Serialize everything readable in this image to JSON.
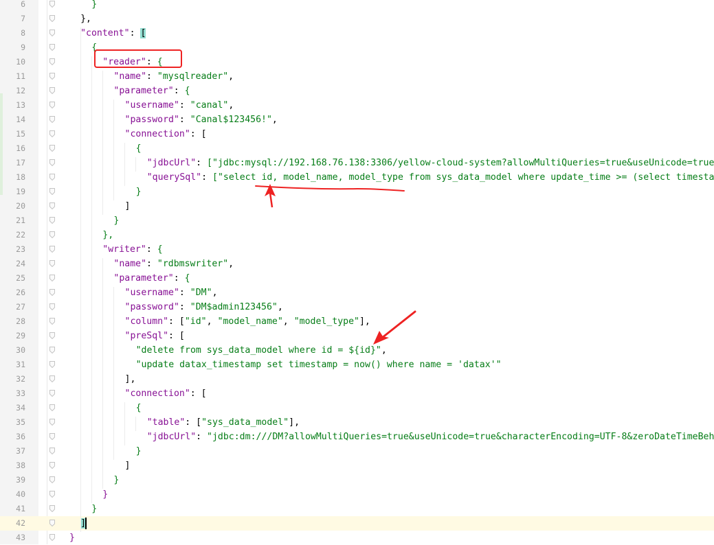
{
  "editor": {
    "lines": [
      {
        "n": "6",
        "indent": 8,
        "tokens": [
          {
            "t": "}",
            "c": "s"
          }
        ]
      },
      {
        "n": "7",
        "indent": 6,
        "tokens": [
          {
            "t": "},",
            "c": "p"
          }
        ]
      },
      {
        "n": "8",
        "indent": 6,
        "tokens": [
          {
            "t": "\"content\"",
            "c": "k"
          },
          {
            "t": ": ",
            "c": "p"
          },
          {
            "t": "[",
            "c": "bh"
          }
        ]
      },
      {
        "n": "9",
        "indent": 8,
        "tokens": [
          {
            "t": "{",
            "c": "s"
          }
        ]
      },
      {
        "n": "10",
        "indent": 10,
        "tokens": [
          {
            "t": "\"reader\"",
            "c": "k"
          },
          {
            "t": ": ",
            "c": "p"
          },
          {
            "t": "{",
            "c": "s"
          }
        ]
      },
      {
        "n": "11",
        "indent": 12,
        "tokens": [
          {
            "t": "\"name\"",
            "c": "k"
          },
          {
            "t": ": ",
            "c": "p"
          },
          {
            "t": "\"mysqlreader\"",
            "c": "s"
          },
          {
            "t": ",",
            "c": "p"
          }
        ]
      },
      {
        "n": "12",
        "indent": 12,
        "tokens": [
          {
            "t": "\"parameter\"",
            "c": "k"
          },
          {
            "t": ": ",
            "c": "p"
          },
          {
            "t": "{",
            "c": "s"
          }
        ]
      },
      {
        "n": "13",
        "indent": 14,
        "tokens": [
          {
            "t": "\"username\"",
            "c": "k"
          },
          {
            "t": ": ",
            "c": "p"
          },
          {
            "t": "\"canal\"",
            "c": "s"
          },
          {
            "t": ",",
            "c": "p"
          }
        ]
      },
      {
        "n": "14",
        "indent": 14,
        "tokens": [
          {
            "t": "\"password\"",
            "c": "k"
          },
          {
            "t": ": ",
            "c": "p"
          },
          {
            "t": "\"Canal$123456!\"",
            "c": "s"
          },
          {
            "t": ",",
            "c": "p"
          }
        ]
      },
      {
        "n": "15",
        "indent": 14,
        "tokens": [
          {
            "t": "\"connection\"",
            "c": "k"
          },
          {
            "t": ": ",
            "c": "p"
          },
          {
            "t": "[",
            "c": "p"
          }
        ]
      },
      {
        "n": "16",
        "indent": 16,
        "tokens": [
          {
            "t": "{",
            "c": "s"
          }
        ]
      },
      {
        "n": "17",
        "indent": 18,
        "tokens": [
          {
            "t": "\"jdbcUrl\"",
            "c": "k"
          },
          {
            "t": ": ",
            "c": "p"
          },
          {
            "t": "[",
            "c": "s"
          },
          {
            "t": "\"jdbc:mysql://192.168.76.138:3306/yellow-cloud-system?allowMultiQueries=true&useUnicode=true",
            "c": "s"
          }
        ]
      },
      {
        "n": "18",
        "indent": 18,
        "tokens": [
          {
            "t": "\"querySql\"",
            "c": "k"
          },
          {
            "t": ": ",
            "c": "p"
          },
          {
            "t": "[",
            "c": "s"
          },
          {
            "t": "\"select id, model_name, model_type from sys_data_model where update_time >= (select timestamp",
            "c": "s"
          }
        ]
      },
      {
        "n": "19",
        "indent": 16,
        "tokens": [
          {
            "t": "}",
            "c": "s"
          }
        ]
      },
      {
        "n": "20",
        "indent": 14,
        "tokens": [
          {
            "t": "]",
            "c": "p"
          }
        ]
      },
      {
        "n": "21",
        "indent": 12,
        "tokens": [
          {
            "t": "}",
            "c": "s"
          }
        ]
      },
      {
        "n": "22",
        "indent": 10,
        "tokens": [
          {
            "t": "},",
            "c": "s"
          }
        ]
      },
      {
        "n": "23",
        "indent": 10,
        "tokens": [
          {
            "t": "\"writer\"",
            "c": "k"
          },
          {
            "t": ": ",
            "c": "p"
          },
          {
            "t": "{",
            "c": "s"
          }
        ]
      },
      {
        "n": "24",
        "indent": 12,
        "tokens": [
          {
            "t": "\"name\"",
            "c": "k"
          },
          {
            "t": ": ",
            "c": "p"
          },
          {
            "t": "\"rdbmswriter\"",
            "c": "s"
          },
          {
            "t": ",",
            "c": "p"
          }
        ]
      },
      {
        "n": "25",
        "indent": 12,
        "tokens": [
          {
            "t": "\"parameter\"",
            "c": "k"
          },
          {
            "t": ": ",
            "c": "p"
          },
          {
            "t": "{",
            "c": "s"
          }
        ]
      },
      {
        "n": "26",
        "indent": 14,
        "tokens": [
          {
            "t": "\"username\"",
            "c": "k"
          },
          {
            "t": ": ",
            "c": "p"
          },
          {
            "t": "\"DM\"",
            "c": "s"
          },
          {
            "t": ",",
            "c": "p"
          }
        ]
      },
      {
        "n": "27",
        "indent": 14,
        "tokens": [
          {
            "t": "\"password\"",
            "c": "k"
          },
          {
            "t": ": ",
            "c": "p"
          },
          {
            "t": "\"DM$admin123456\"",
            "c": "s"
          },
          {
            "t": ",",
            "c": "p"
          }
        ]
      },
      {
        "n": "28",
        "indent": 14,
        "tokens": [
          {
            "t": "\"column\"",
            "c": "k"
          },
          {
            "t": ": [",
            "c": "p"
          },
          {
            "t": "\"id\"",
            "c": "s"
          },
          {
            "t": ", ",
            "c": "p"
          },
          {
            "t": "\"model_name\"",
            "c": "s"
          },
          {
            "t": ", ",
            "c": "p"
          },
          {
            "t": "\"model_type\"",
            "c": "s"
          },
          {
            "t": "],",
            "c": "p"
          }
        ]
      },
      {
        "n": "29",
        "indent": 14,
        "tokens": [
          {
            "t": "\"preSql\"",
            "c": "k"
          },
          {
            "t": ": [",
            "c": "p"
          }
        ]
      },
      {
        "n": "30",
        "indent": 16,
        "tokens": [
          {
            "t": "\"delete from sys_data_model where id = ${id}\"",
            "c": "s"
          },
          {
            "t": ",",
            "c": "p"
          }
        ]
      },
      {
        "n": "31",
        "indent": 16,
        "tokens": [
          {
            "t": "\"update datax_timestamp set timestamp = now() where name = 'datax'\"",
            "c": "s"
          }
        ]
      },
      {
        "n": "32",
        "indent": 14,
        "tokens": [
          {
            "t": "],",
            "c": "p"
          }
        ]
      },
      {
        "n": "33",
        "indent": 14,
        "tokens": [
          {
            "t": "\"connection\"",
            "c": "k"
          },
          {
            "t": ": [",
            "c": "p"
          }
        ]
      },
      {
        "n": "34",
        "indent": 16,
        "tokens": [
          {
            "t": "{",
            "c": "s"
          }
        ]
      },
      {
        "n": "35",
        "indent": 18,
        "tokens": [
          {
            "t": "\"table\"",
            "c": "k"
          },
          {
            "t": ": [",
            "c": "p"
          },
          {
            "t": "\"sys_data_model\"",
            "c": "s"
          },
          {
            "t": "],",
            "c": "p"
          }
        ]
      },
      {
        "n": "36",
        "indent": 18,
        "tokens": [
          {
            "t": "\"jdbcUrl\"",
            "c": "k"
          },
          {
            "t": ": ",
            "c": "p"
          },
          {
            "t": "\"jdbc:dm:///DM?allowMultiQueries=true&useUnicode=true&characterEncoding=UTF-8&zeroDateTimeBeh",
            "c": "s"
          }
        ]
      },
      {
        "n": "37",
        "indent": 16,
        "tokens": [
          {
            "t": "}",
            "c": "s"
          }
        ]
      },
      {
        "n": "38",
        "indent": 14,
        "tokens": [
          {
            "t": "]",
            "c": "p"
          }
        ]
      },
      {
        "n": "39",
        "indent": 12,
        "tokens": [
          {
            "t": "}",
            "c": "s"
          }
        ]
      },
      {
        "n": "40",
        "indent": 10,
        "tokens": [
          {
            "t": "}",
            "c": "k"
          }
        ]
      },
      {
        "n": "41",
        "indent": 8,
        "tokens": [
          {
            "t": "}",
            "c": "s"
          }
        ]
      },
      {
        "n": "42",
        "indent": 6,
        "tokens": [
          {
            "t": "]",
            "c": "bh"
          }
        ]
      },
      {
        "n": "43",
        "indent": 4,
        "tokens": [
          {
            "t": "}",
            "c": "k"
          }
        ]
      }
    ],
    "current_line": "42"
  },
  "colors": {
    "key": "#871094",
    "string": "#067d17",
    "bracket_highlight": "#92ddd0",
    "current_line": "#fffae3",
    "annotation": "#ee2222"
  }
}
